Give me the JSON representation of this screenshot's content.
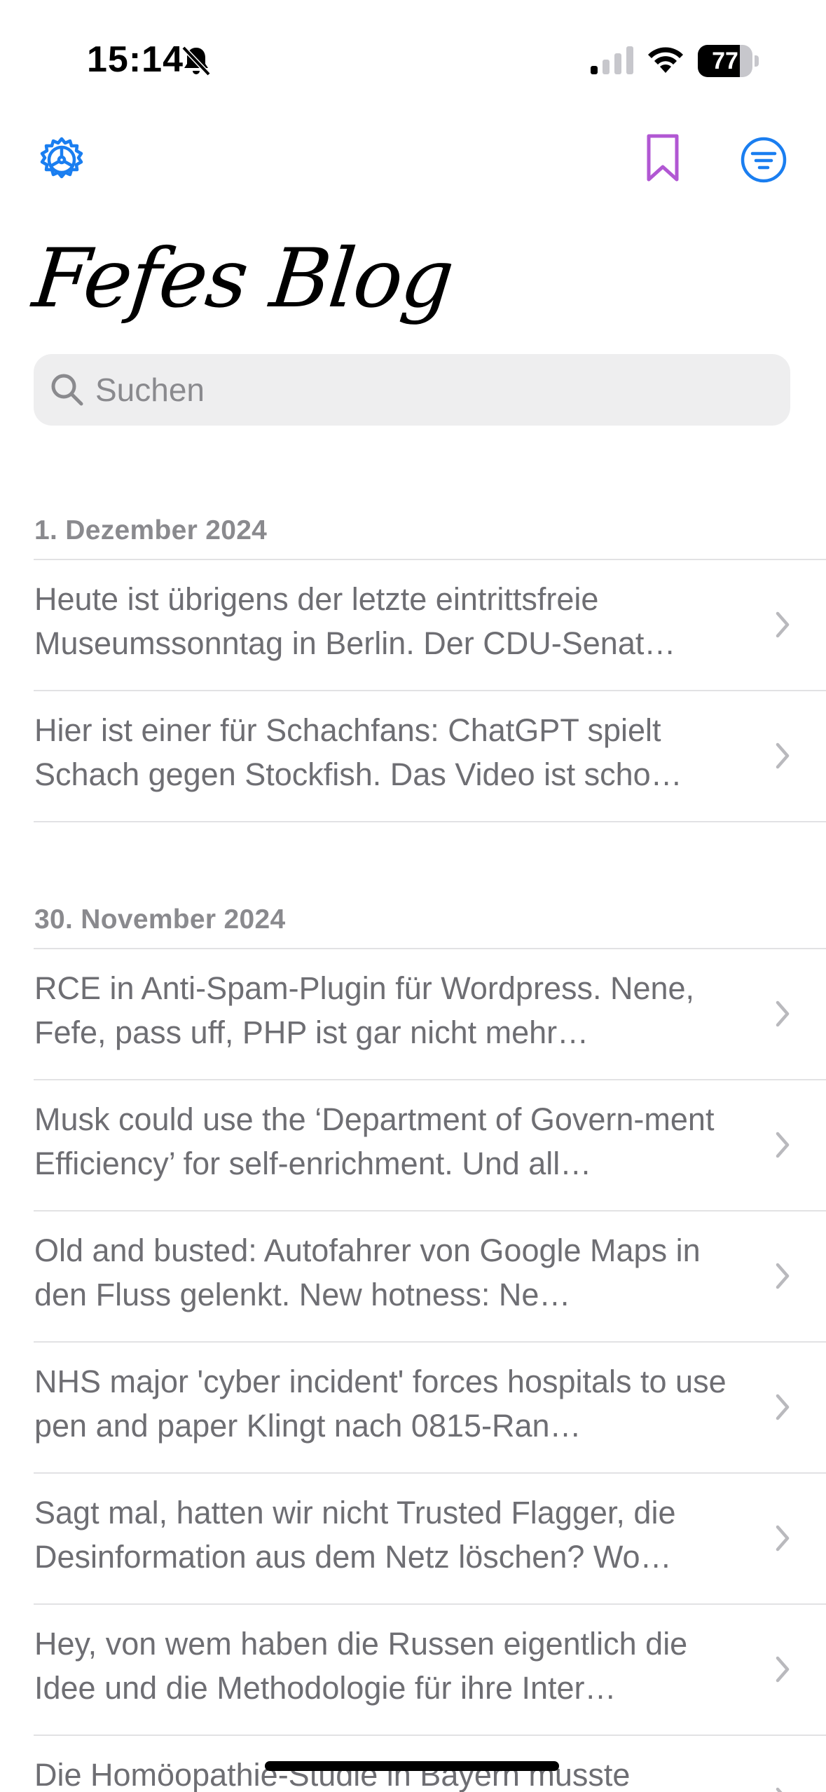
{
  "status_bar": {
    "time": "15:14",
    "battery_level": "77",
    "battery_fraction": 0.77,
    "icons": [
      "bell-slash-icon",
      "cellular-signal-icon",
      "wifi-icon",
      "battery-icon"
    ]
  },
  "toolbar": {
    "settings_icon": "gear-icon",
    "bookmark_icon": "bookmark-icon",
    "filter_icon": "filter-icon",
    "accent_color": "#1a7ef0",
    "bookmark_color": "#b157d3"
  },
  "app": {
    "title": "Fefes Blog"
  },
  "search": {
    "placeholder": "Suchen",
    "value": ""
  },
  "sections": [
    {
      "date": "1. Dezember 2024",
      "posts": [
        "Heute ist übrigens der letzte eintrittsfreie Museumssonntag in Berlin. Der CDU-Senat…",
        "Hier ist einer für Schachfans: ChatGPT spielt Schach gegen Stockfish. Das Video ist scho…"
      ]
    },
    {
      "date": "30. November 2024",
      "posts": [
        "RCE in Anti-Spam-Plugin für Wordpress. Nene, Fefe, pass uff, PHP ist gar nicht mehr…",
        "Musk could use the ‘Department of Govern-ment Efficiency’ for self-enrichment. Und all…",
        "Old and busted: Autofahrer von Google Maps in den Fluss gelenkt. New hotness: Ne…",
        "NHS major 'cyber incident' forces hospitals to use pen and paper Klingt nach 0815-Ran…",
        "Sagt mal, hatten wir nicht Trusted Flagger, die Desinformation aus dem Netz löschen? Wo…",
        "Hey, von wem haben die Russen eigentlich die Idee und die Methodologie für ihre Inter…",
        "Die Homöopathie-Studie in Bayern musste abgebrochen werden – Wir haben heftig die…"
      ]
    }
  ]
}
